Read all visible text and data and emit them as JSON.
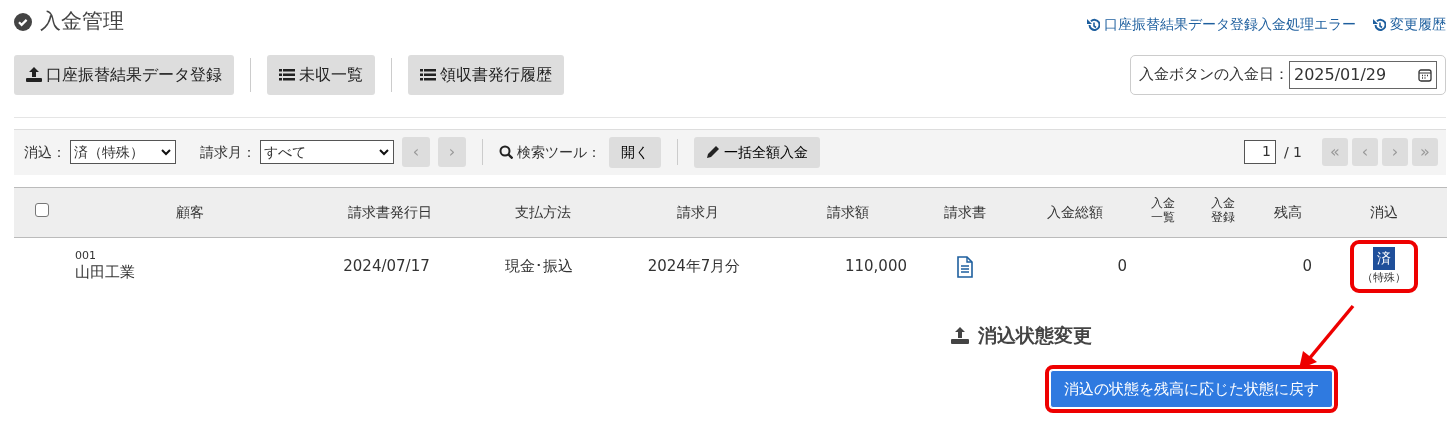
{
  "title": "入金管理",
  "links": [
    "口座振替結果データ登録入金処理エラー",
    "変更履歴"
  ],
  "toolbar": [
    {
      "label": "口座振替結果データ登録",
      "kind": "upload"
    },
    {
      "label": "未収一覧",
      "kind": "list"
    },
    {
      "label": "領収書発行履歴",
      "kind": "list"
    }
  ],
  "payment_date": {
    "label": "入金ボタンの入金日：",
    "value": "2025/01/29"
  },
  "filters": {
    "reconcile": {
      "label": "消込：",
      "value": "済（特殊）"
    },
    "billing_month": {
      "label": "請求月：",
      "value": "すべて",
      "prev": "‹",
      "next": "›",
      "disabled": true
    },
    "search_tool": {
      "label": "検索ツール：",
      "button": "開く"
    },
    "bulk_button": "一括全額入金",
    "page": {
      "current": "1",
      "total": "/ 1",
      "buttons": [
        "«",
        "‹",
        "›",
        "»"
      ],
      "disabled": true
    }
  },
  "table": {
    "select_all": {
      "checked": false
    },
    "columns": [
      {
        "label": "顧客",
        "stacked": false
      },
      {
        "label": "請求書発行日",
        "stacked": false
      },
      {
        "label": "支払方法",
        "stacked": false
      },
      {
        "label": "請求月",
        "stacked": false
      },
      {
        "label": "請求額",
        "stacked": false
      },
      {
        "label": "請求書",
        "stacked": false
      },
      {
        "label": "入金総額",
        "stacked": false
      },
      {
        "label": "入金一覧",
        "stacked": true
      },
      {
        "label": "入金登録",
        "stacked": true
      },
      {
        "label": "残高",
        "stacked": false
      },
      {
        "label": "消込",
        "stacked": false
      }
    ],
    "rows": [
      {
        "code": "001",
        "customer": "山田工業",
        "issue_date": "2024/07/17",
        "payment_method": "現金･振込",
        "billing_month": "2024年7月分",
        "amount": "110,000",
        "paid_total": "0",
        "balance": "0",
        "status": {
          "label": "済",
          "note": "（特殊）"
        }
      }
    ]
  },
  "panel": {
    "title": "消込状態変更",
    "button": "消込の状態を残高に応じた状態に戻す"
  }
}
